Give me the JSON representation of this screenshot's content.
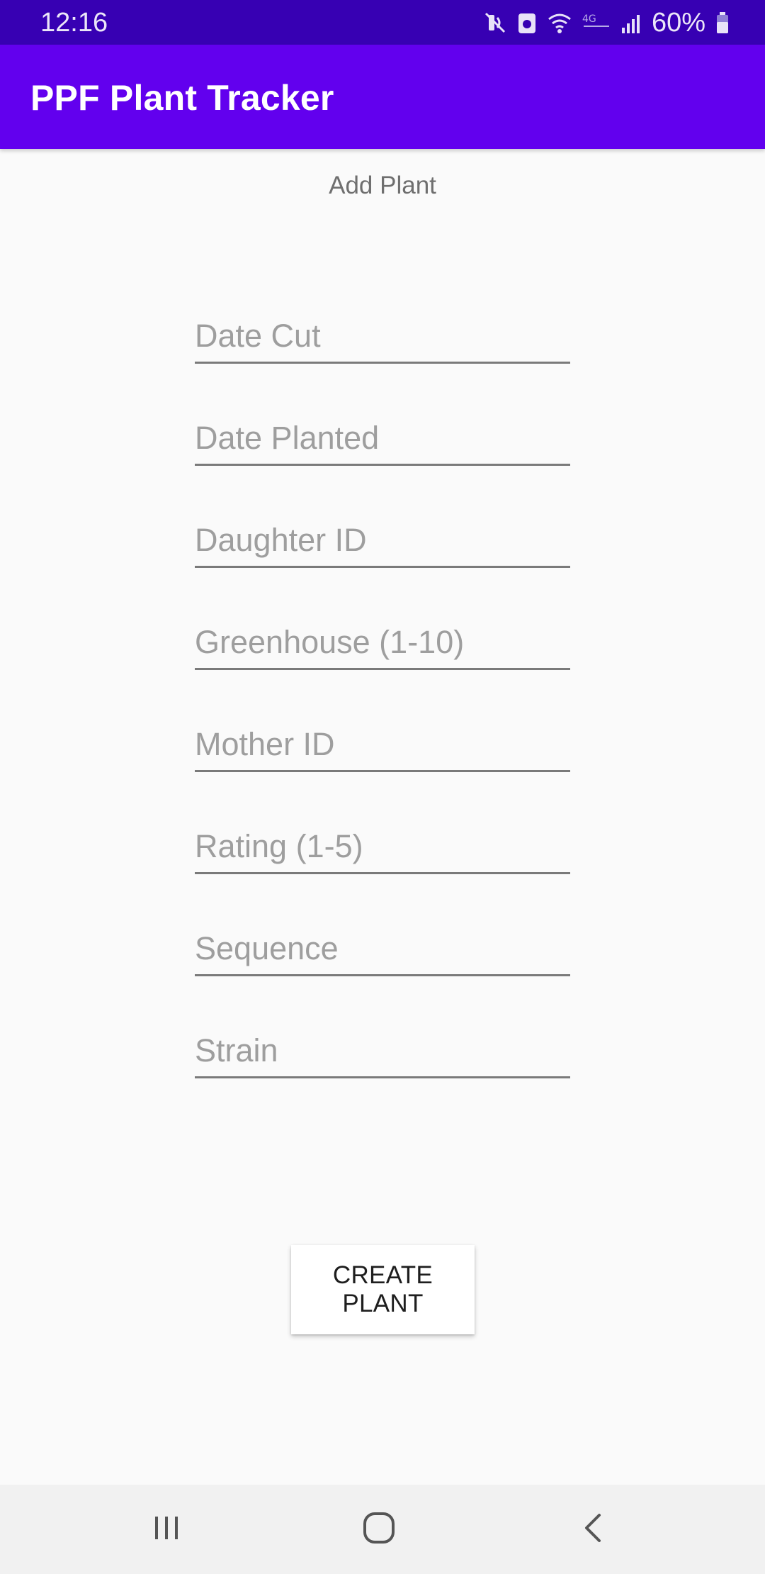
{
  "status_bar": {
    "time": "12:16",
    "battery_percent": "60%",
    "icons": [
      "mute-icon",
      "vpn-icon",
      "wifi-icon",
      "lte-icon",
      "signal-icon",
      "battery-icon"
    ]
  },
  "app_bar": {
    "title": "PPF Plant Tracker"
  },
  "page": {
    "heading": "Add Plant"
  },
  "form": {
    "fields": [
      {
        "placeholder": "Date Cut",
        "value": ""
      },
      {
        "placeholder": "Date Planted",
        "value": ""
      },
      {
        "placeholder": "Daughter ID",
        "value": ""
      },
      {
        "placeholder": "Greenhouse (1-10)",
        "value": ""
      },
      {
        "placeholder": "Mother ID",
        "value": ""
      },
      {
        "placeholder": "Rating (1-5)",
        "value": ""
      },
      {
        "placeholder": "Sequence",
        "value": ""
      },
      {
        "placeholder": "Strain",
        "value": ""
      }
    ],
    "submit_label": "CREATE PLANT"
  },
  "nav_bar": {
    "buttons": [
      "recent-apps-icon",
      "home-icon",
      "back-icon"
    ]
  },
  "colors": {
    "status_bar": "#3700b3",
    "app_bar": "#6200ee",
    "background": "#fafafa"
  }
}
